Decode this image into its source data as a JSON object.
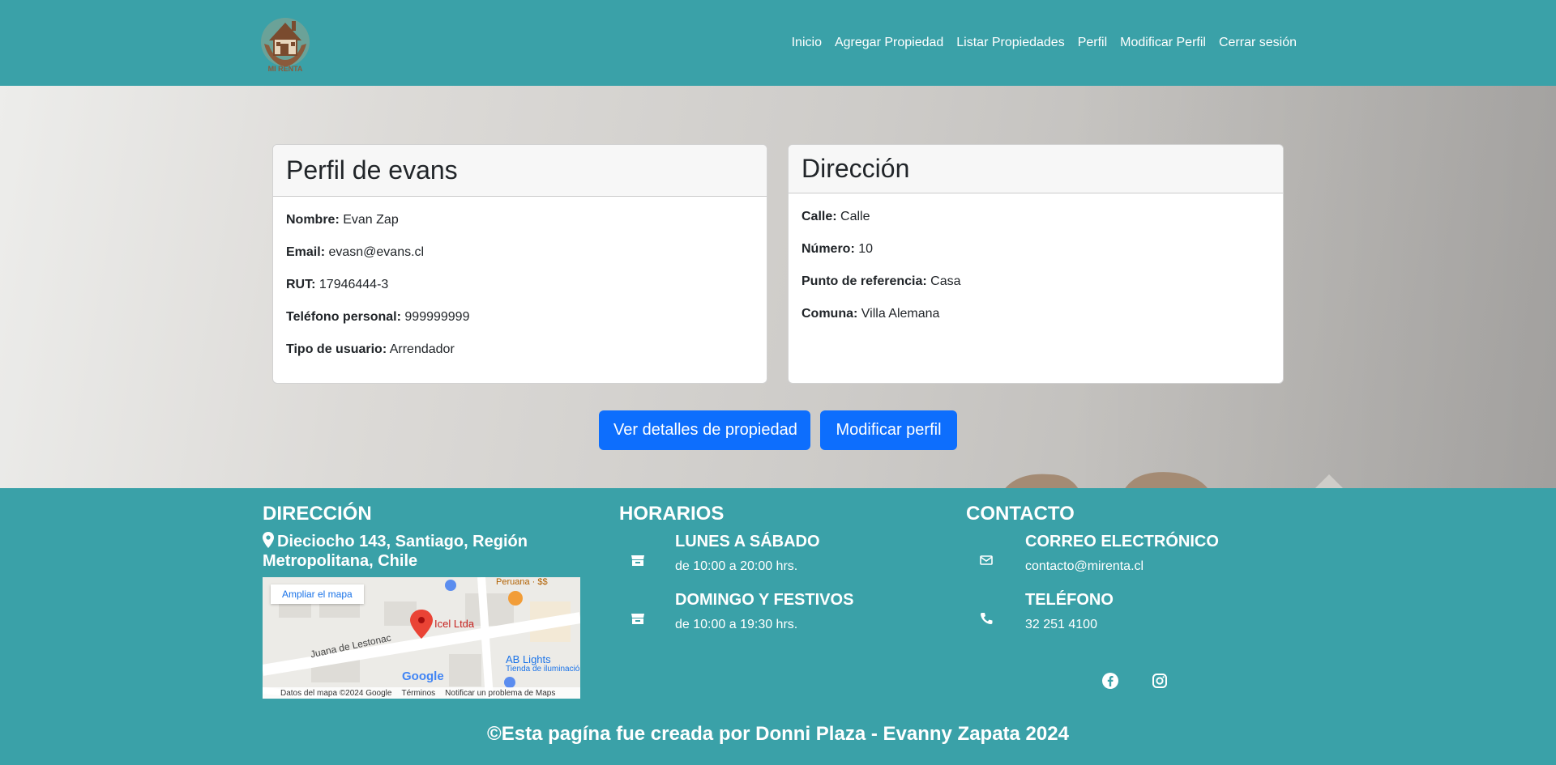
{
  "nav": {
    "logo_text": "MI RENTA",
    "links": [
      "Inicio",
      "Agregar Propiedad",
      "Listar Propiedades",
      "Perfil",
      "Modificar Perfil",
      "Cerrar sesión"
    ]
  },
  "profile": {
    "title": "Perfil de evans",
    "fields": [
      {
        "label": "Nombre:",
        "value": "Evan Zap"
      },
      {
        "label": "Email:",
        "value": "evasn@evans.cl"
      },
      {
        "label": "RUT:",
        "value": "17946444-3"
      },
      {
        "label": "Teléfono personal:",
        "value": "999999999"
      },
      {
        "label": "Tipo de usuario:",
        "value": "Arrendador"
      }
    ]
  },
  "address": {
    "title": "Dirección",
    "fields": [
      {
        "label": "Calle:",
        "value": "Calle"
      },
      {
        "label": "Número:",
        "value": "10"
      },
      {
        "label": "Punto de referencia:",
        "value": "Casa"
      },
      {
        "label": "Comuna:",
        "value": "Villa Alemana"
      }
    ]
  },
  "buttons": {
    "details": "Ver detalles de propiedad",
    "edit": "Modificar perfil"
  },
  "footer": {
    "address_title": "DIRECCIÓN",
    "address_text": "Dieciocho 143, Santiago, Región Metropolitana, Chile",
    "map": {
      "enlarge": "Ampliar el mapa",
      "place": "Icel Ltda",
      "street": "Juana de Lestonac",
      "shop1": "Peruana · $$",
      "shop2": "AB Lights",
      "shop2_sub": "Tienda de iluminación",
      "google": "Google",
      "attr_data": "Datos del mapa ©2024 Google",
      "attr_terms": "Términos",
      "attr_report": "Notificar un problema de Maps"
    },
    "hours_title": "HORARIOS",
    "hours": [
      {
        "title": "LUNES A SÁBADO",
        "text": "de 10:00 a 20:00 hrs."
      },
      {
        "title": "DOMINGO Y FESTIVOS",
        "text": "de 10:00 a 19:30 hrs."
      }
    ],
    "contact_title": "CONTACTO",
    "contact": [
      {
        "title": "CORREO ELECTRÓNICO",
        "text": "contacto@mirenta.cl"
      },
      {
        "title": "TELÉFONO",
        "text": "32 251 4100"
      }
    ],
    "copyright": "©Esta pagína fue creada por Donni Plaza - Evanny Zapata 2024"
  },
  "colors": {
    "teal": "#3aa1a8",
    "primary": "#0d6efd"
  }
}
